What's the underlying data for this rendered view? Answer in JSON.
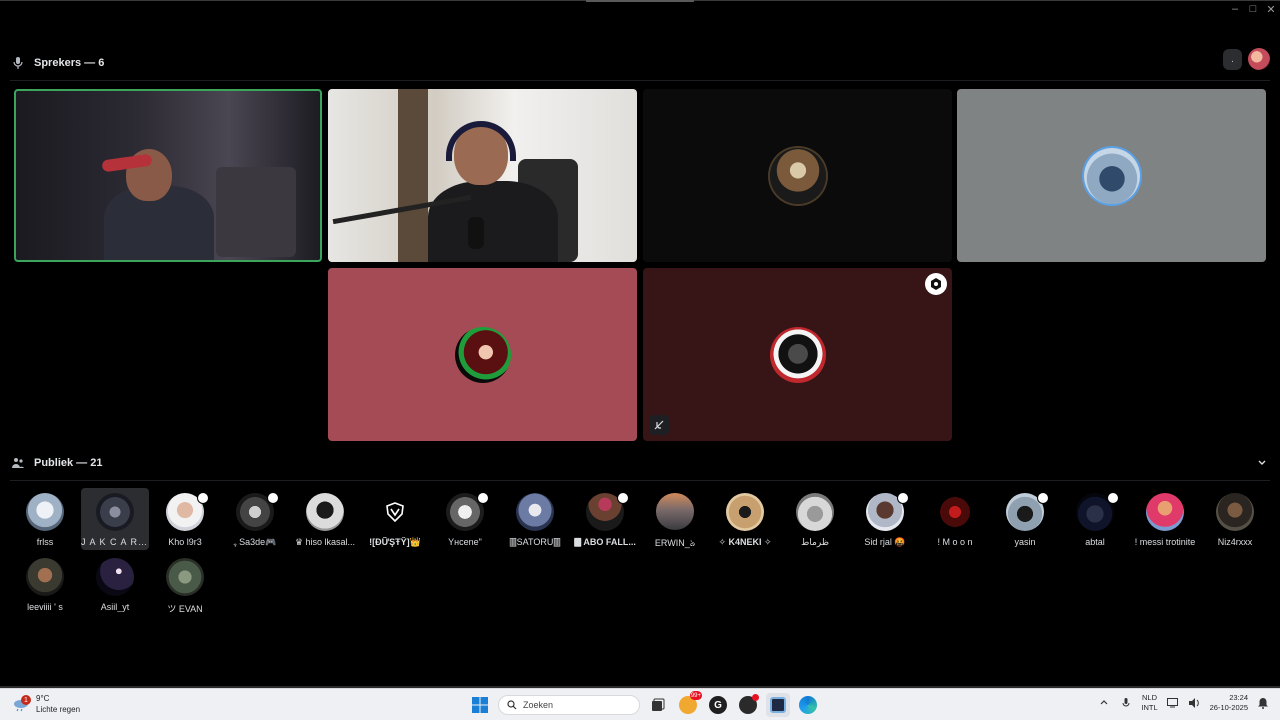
{
  "speakers": {
    "header": "Sprekers — 6"
  },
  "audience": {
    "header": "Publiek — 21",
    "members": [
      {
        "name": "frlss"
      },
      {
        "name": "J A K C A R L ..."
      },
      {
        "name": "Kho l9r3"
      },
      {
        "name": "ﮩ Sa3de🎮"
      },
      {
        "name": "♛ hiso lkasal..."
      },
      {
        "name": "![ĐỮŞŦŶ]👑"
      },
      {
        "name": "Yнcene\""
      },
      {
        "name": "🀫SATORU🀫"
      },
      {
        "name": "🀫 ABO FALL..."
      },
      {
        "name": "ERWIN_ঌ"
      },
      {
        "name": "✧ K4NEKI ✧"
      },
      {
        "name": "ظرماط"
      },
      {
        "name": "Sid rjal 🤬"
      },
      {
        "name": "! M o o n"
      },
      {
        "name": "yasin"
      },
      {
        "name": "abtal"
      },
      {
        "name": "! messi trotinite"
      },
      {
        "name": "Niz4rxxx"
      },
      {
        "name": "leeviiii ' s"
      },
      {
        "name": "Asiil_yt"
      },
      {
        "name": "ツ EVAN"
      }
    ]
  },
  "top_right": {
    "more_label": "."
  },
  "taskbar": {
    "weather_badge": "1",
    "temperature": "9°C",
    "condition": "Lichte regen",
    "search_placeholder": "Zoeken",
    "app_badge": "99+",
    "lang_primary": "NLD",
    "lang_secondary": "INTL",
    "time": "23:24",
    "date": "26-10-2025"
  },
  "colors": {
    "speaking_border": "#3ba55c",
    "tile_pink": "#a54b56",
    "tile_dark_red": "#371517",
    "tile_gray": "#808383"
  }
}
